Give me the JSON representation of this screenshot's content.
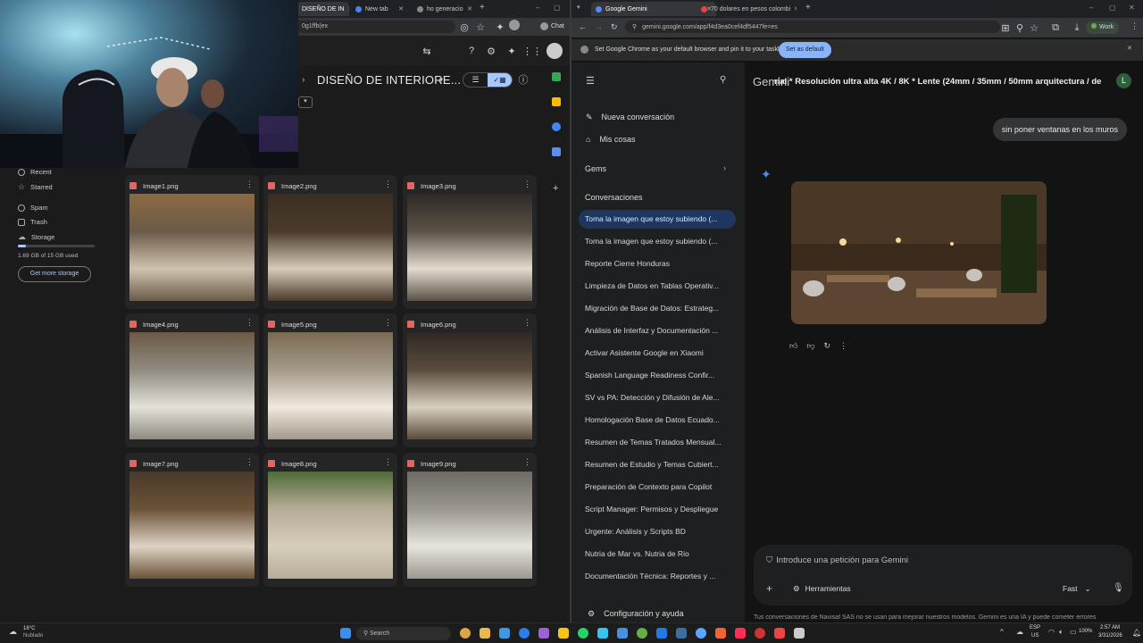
{
  "left_window": {
    "tabs": [
      {
        "label": "DISEÑO DE IN"
      },
      {
        "label": "New tab"
      },
      {
        "label": "ho generacio"
      }
    ],
    "url": "0g1ffb(ex",
    "chat_label": "Chat",
    "folder_title": "DISEÑO DE INTERIORE...",
    "sidebar": {
      "items": [
        {
          "label": "Recent"
        },
        {
          "label": "Starred"
        },
        {
          "label": "Spam"
        },
        {
          "label": "Trash"
        },
        {
          "label": "Storage"
        }
      ],
      "storage_text": "1.69 GB of 15 GB used",
      "storage_fraction": 0.11,
      "get_storage_label": "Get more storage"
    },
    "files": [
      {
        "name": "Image1.png",
        "thumb": "warm-cafe-bar"
      },
      {
        "name": "Image2.png",
        "thumb": "wood-wall-lounge"
      },
      {
        "name": "Image3.png",
        "thumb": "pergola-ceiling"
      },
      {
        "name": "Image4.png",
        "thumb": "bright-hall"
      },
      {
        "name": "Image5.png",
        "thumb": "arch-corridor"
      },
      {
        "name": "Image6.png",
        "thumb": "pergola-dining"
      },
      {
        "name": "Image7.png",
        "thumb": "wood-lounge"
      },
      {
        "name": "Image8.png",
        "thumb": "bamboo-garden"
      },
      {
        "name": "Image9.png",
        "thumb": "bathroom"
      }
    ]
  },
  "right_window": {
    "tabs": [
      {
        "label": "Google Gemini"
      },
      {
        "label": "70 dolares en pesos colombi"
      }
    ],
    "url": "gemini.google.com/app/f4d3ea0cef4df5447fe=es",
    "profile_label": "Work",
    "infobar": {
      "text": "Set Google Chrome as your default browser and pin it to your taskbar",
      "button": "Set as default"
    },
    "gemini": {
      "brand": "Gemini",
      "prompt_title": "rial * Resolución ultra alta 4K / 8K * Lente (24mm / 35mm / 50mm arquitectura / de",
      "avatar_letter": "L",
      "new_chat": "Nueva conversación",
      "my_stuff": "Mis cosas",
      "gems": "Gems",
      "conversations_header": "Conversaciones",
      "conversations": [
        "Toma la imagen que estoy subiendo (...",
        "Toma la imagen que estoy subiendo (...",
        "Reporte Cierre Honduras",
        "Limpieza de Datos en Tablas Operativ...",
        "Migración de Base de Datos: Estrateg...",
        "Análisis de Interfaz y Documentación ...",
        "Activar Asistente Google en Xiaomi",
        "Spanish Language Readiness Confir...",
        "SV vs PA: Detección y Difusión de Ale...",
        "Homologación Base de Datos Ecuado...",
        "Resumen de Temas Tratados Mensual...",
        "Resumen de Estudio y Temas Cubiert...",
        "Preparación de Contexto para Copilot",
        "Script Manager: Permisos y Despliegue",
        "Urgente: Análisis y Scripts BD",
        "Nutria de Mar vs. Nutria de Rio",
        "Documentación Técnica: Reportes y ..."
      ],
      "settings": "Configuración y ayuda",
      "user_message": "sin poner ventanas en los muros",
      "input_placeholder": "Introduce una petición para Gemini",
      "tools_label": "Herramientas",
      "mode_label": "Fast",
      "disclaimer": "Tus conversaciones de Navisaf SAS no se usan para mejorar nuestros modelos. Gemini es una IA y puede cometer errores"
    }
  },
  "taskbar": {
    "weather_temp": "18°C",
    "weather_text": "Nublado",
    "search_label": "Search",
    "lang": "ESP",
    "lang2": "US",
    "battery": "100%",
    "time": "2:57 AM",
    "date": "3/31/2026"
  }
}
